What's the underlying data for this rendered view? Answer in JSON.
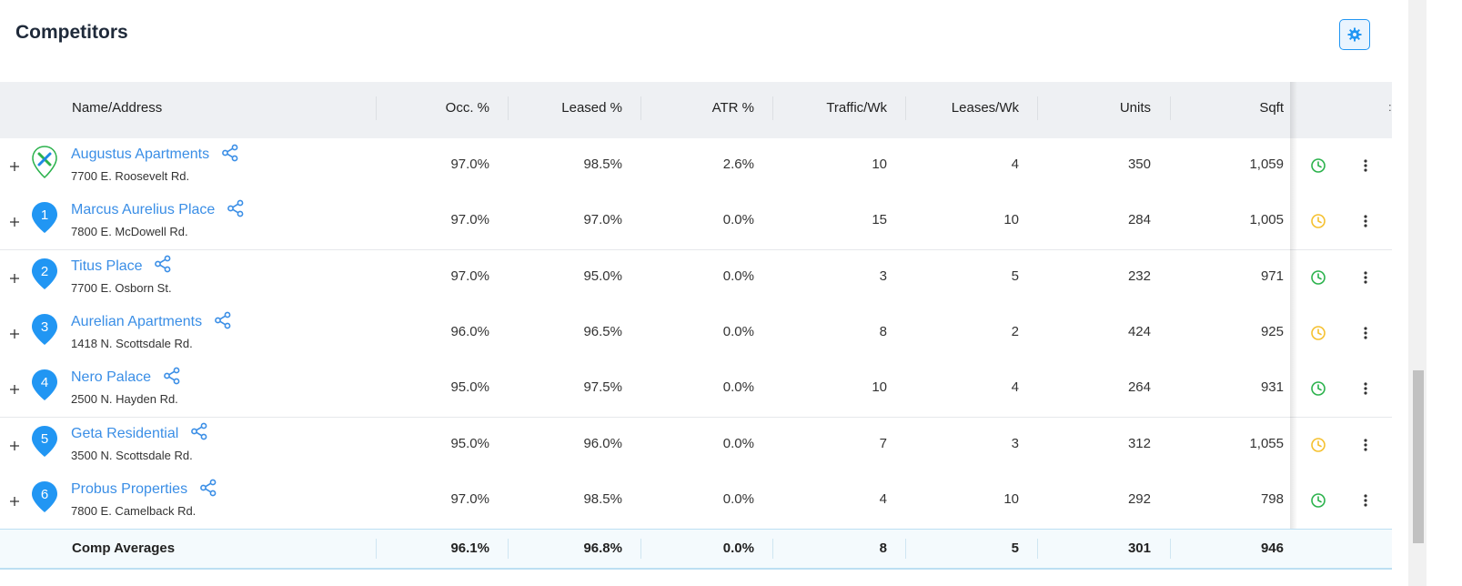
{
  "page": {
    "title": "Competitors"
  },
  "columns": [
    "Name/Address",
    "Occ. %",
    "Leased %",
    "ATR %",
    "Traffic/Wk",
    "Leases/Wk",
    "Units",
    "Sqft"
  ],
  "rows": [
    {
      "marker": "X",
      "name": "Augustus Apartments",
      "address": "7700 E. Roosevelt Rd.",
      "occ": "97.0%",
      "leased": "98.5%",
      "atr": "2.6%",
      "traffic": "10",
      "leases": "4",
      "units": "350",
      "sqft": "1,059",
      "status": "green"
    },
    {
      "marker": "1",
      "name": "Marcus Aurelius Place",
      "address": "7800 E. McDowell Rd.",
      "occ": "97.0%",
      "leased": "97.0%",
      "atr": "0.0%",
      "traffic": "15",
      "leases": "10",
      "units": "284",
      "sqft": "1,005",
      "status": "yellow"
    },
    {
      "marker": "2",
      "name": "Titus Place",
      "address": "7700 E. Osborn St.",
      "occ": "97.0%",
      "leased": "95.0%",
      "atr": "0.0%",
      "traffic": "3",
      "leases": "5",
      "units": "232",
      "sqft": "971",
      "status": "green"
    },
    {
      "marker": "3",
      "name": "Aurelian Apartments",
      "address": "1418 N. Scottsdale Rd.",
      "occ": "96.0%",
      "leased": "96.5%",
      "atr": "0.0%",
      "traffic": "8",
      "leases": "2",
      "units": "424",
      "sqft": "925",
      "status": "yellow"
    },
    {
      "marker": "4",
      "name": "Nero Palace",
      "address": "2500 N. Hayden Rd.",
      "occ": "95.0%",
      "leased": "97.5%",
      "atr": "0.0%",
      "traffic": "10",
      "leases": "4",
      "units": "264",
      "sqft": "931",
      "status": "green"
    },
    {
      "marker": "5",
      "name": "Geta Residential",
      "address": "3500 N. Scottsdale Rd.",
      "occ": "95.0%",
      "leased": "96.0%",
      "atr": "0.0%",
      "traffic": "7",
      "leases": "3",
      "units": "312",
      "sqft": "1,055",
      "status": "yellow"
    },
    {
      "marker": "6",
      "name": "Probus Properties",
      "address": "7800 E. Camelback Rd.",
      "occ": "97.0%",
      "leased": "98.5%",
      "atr": "0.0%",
      "traffic": "4",
      "leases": "10",
      "units": "292",
      "sqft": "798",
      "status": "green"
    }
  ],
  "averages": {
    "label": "Comp Averages",
    "occ": "96.1%",
    "leased": "96.8%",
    "atr": "0.0%",
    "traffic": "8",
    "leases": "5",
    "units": "301",
    "sqft": "946"
  },
  "colors": {
    "accent": "#2196f3",
    "link": "#3a8ee6",
    "status_green": "#2bb24c",
    "status_yellow": "#f5c02e",
    "logo_green": "#2bb24c",
    "logo_blue": "#1e88e5"
  },
  "icons": {
    "settings": "gear-icon",
    "expand": "plus-icon",
    "share": "share-icon",
    "status": "clock-icon",
    "menu": "more-vertical-icon",
    "marker": "map-pin-icon"
  }
}
